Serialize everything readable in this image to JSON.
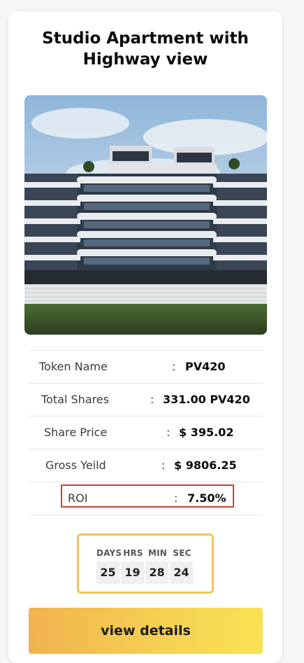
{
  "card": {
    "title_line1": "Studio Apartment with",
    "title_line2": "Highway view"
  },
  "image": {
    "description_icon": "building-photo"
  },
  "details": [
    {
      "label": "Token Name",
      "value": "PV420"
    },
    {
      "label": "Total Shares",
      "value": "331.00 PV420"
    },
    {
      "label": "Share Price",
      "value": "$ 395.02"
    },
    {
      "label": "Gross Yeild",
      "value": "$ 9806.25"
    },
    {
      "label": "ROI",
      "value": "7.50%"
    }
  ],
  "separator": ":",
  "countdown": {
    "days_label": "DAYS",
    "hrs_label": "HRS",
    "min_label": "MIN",
    "sec_label": "SEC",
    "days": "25",
    "hrs": "19",
    "min": "28",
    "sec": "24"
  },
  "button": {
    "label": "view details"
  },
  "colors": {
    "highlight_border": "#c44730",
    "countdown_border": "#f1c55a",
    "button_gradient_start": "#f1b24f",
    "button_gradient_end": "#f9e256"
  }
}
